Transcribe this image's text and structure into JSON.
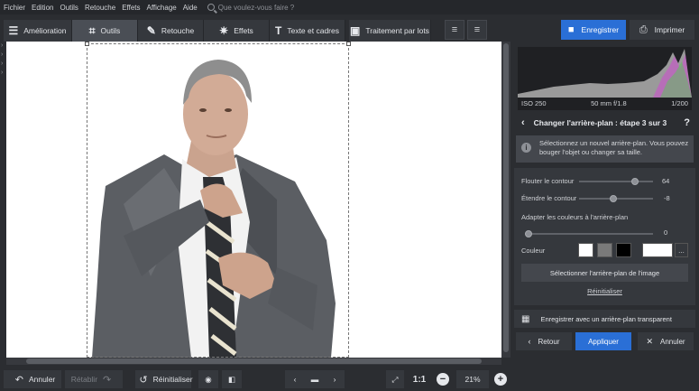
{
  "menu": {
    "items": [
      "Fichier",
      "Edition",
      "Outils",
      "Retouche",
      "Effets",
      "Affichage",
      "Aide"
    ],
    "search_placeholder": "Que voulez-vous faire ?"
  },
  "toolbar": {
    "tabs": [
      {
        "label": "Amélioration",
        "icon": "sliders-icon"
      },
      {
        "label": "Outils",
        "icon": "crop-icon"
      },
      {
        "label": "Retouche",
        "icon": "brush-icon"
      },
      {
        "label": "Effets",
        "icon": "sparkle-icon"
      },
      {
        "label": "Texte et cadres",
        "icon": "text-icon"
      },
      {
        "label": "Traitement par lots",
        "icon": "batch-icon"
      }
    ],
    "active_tab": "Outils",
    "save_label": "Enregistrer",
    "print_label": "Imprimer"
  },
  "histogram": {
    "iso": "ISO 250",
    "lens": "50 mm f/1.8",
    "shutter": "1/200"
  },
  "panel": {
    "step_title": "Changer l'arrière-plan : étape 3 sur 3",
    "help": "?",
    "info_text": "Sélectionnez un nouvel arrière-plan. Vous pouvez bouger l'objet ou changer sa taille.",
    "blur_label": "Flouter le contour",
    "blur_value": "64",
    "blur_level": 0.78,
    "extend_label": "Étendre le contour",
    "extend_value": "-8",
    "extend_level": 0.46,
    "adapt_label": "Adapter les couleurs à l'arrière-plan",
    "adapt_value": "0",
    "adapt_level": 0.0,
    "color_label": "Couleur",
    "swatch_colors": [
      "#ffffff",
      "#7a7a7a",
      "#000000"
    ],
    "selected_color": "#ffffff",
    "more_label": "...",
    "select_bg_label": "Sélectionner l'arrière-plan de l'image",
    "reset_label": "Réinitialiser",
    "save_transparent_label": "Enregistrer avec un arrière-plan transparent",
    "back_label": "Retour",
    "apply_label": "Appliquer",
    "cancel_label": "Annuler"
  },
  "bottom": {
    "undo_label": "Annuler",
    "redo_label": "Rétablir",
    "reset_label": "Réinitialiser",
    "ratio_label": "1:1",
    "zoom_value": "21%"
  },
  "colors": {
    "accent": "#2a6fd6",
    "background": "#2b2d31"
  }
}
